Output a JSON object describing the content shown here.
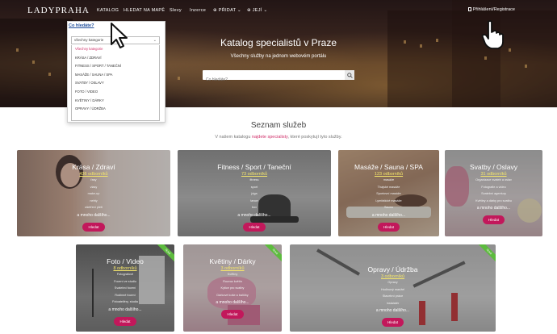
{
  "nav": {
    "logo": "LADYPRAHA",
    "items": [
      "KATALOG",
      "HLEDAT NA MAPĚ",
      "Slevy",
      "Inzerce",
      "⊕ PŘIDAT ⌄",
      "⊕ JEJÍ ⌄"
    ],
    "login": "Přihlášení/Registrace"
  },
  "hero": {
    "title": "Katalog specialistů v Praze",
    "subtitle": "Všechny služby na jednom webovém portálu",
    "search_placeholder": "Co hledáte?"
  },
  "dropdown": {
    "heading": "Co hledáte?",
    "selected": "všechny kategorie",
    "options": [
      "Všechny kategorie",
      "KRÁSA / ZDRAVÍ",
      "FITNESS / SPORT / TANEČNÍ",
      "MASÁŽE / SAUNA / SPA",
      "SVATBY / OSLAVY",
      "FOTO / VIDEO",
      "KVĚTINY / DÁRKY",
      "OPRAVY / ÚDRŽBA"
    ]
  },
  "section": {
    "title": "Seznam služeb",
    "subtitle_pre": "V našem katalogu ",
    "subtitle_link": "najdete specialisty",
    "subtitle_post": ", které poskytují tyto služby."
  },
  "cards": [
    {
      "title": "Krása / Zdraví",
      "count": "436 odborníků",
      "items": [
        "řasy",
        "vlasy",
        "make-up",
        "nehty",
        "ošetření pleti"
      ],
      "more": "a mnoho dalšího...",
      "button": "Hledat"
    },
    {
      "title": "Fitness / Sport / Taneční",
      "count": "73 odborníků",
      "items": [
        "fitness",
        "sport",
        "jóga",
        "tance",
        "box"
      ],
      "more": "a mnoho dalšího...",
      "button": "Hledat"
    },
    {
      "title": "Masáže / Sauna / SPA",
      "count": "123 odborníků",
      "items": [
        "masáže",
        "Thajské masáže",
        "Sportovní masáže",
        "Lymfatické masáže",
        "Saunu"
      ],
      "more": "a mnoho dalšího...",
      "button": "Hledat"
    },
    {
      "title": "Svatby / Oslavy",
      "count": "31 odborníků",
      "items": [
        "Organizace svateb a oslav",
        "Fotografie a video",
        "Svatební agentury",
        "Květiny a dárky pro svatbu"
      ],
      "more": "a mnoho dalšího...",
      "button": "Hledat"
    },
    {
      "title": "Foto / Video",
      "count": "8 odborníků",
      "items": [
        "Fotografové",
        "Focení ve studiu",
        "Svatební focení",
        "Rodinné focení",
        "Fotoateliéry, studia"
      ],
      "more": "a mnoho dalšího...",
      "button": "Hledat"
    },
    {
      "title": "Květiny / Dárky",
      "count": "3 odborníků",
      "items": [
        "Květiny",
        "Rozvoz květin",
        "Kytice pro svatby",
        "Dárkové koše a balíčky"
      ],
      "more": "a mnoho dalšího...",
      "button": "Hledat"
    },
    {
      "title": "Opravy / Údržba",
      "count": "3 odborníků",
      "items": [
        "Opravy",
        "Hodinový manžel",
        "Stavební práce",
        "Instalatér"
      ],
      "more": "a mnoho dalšího...",
      "button": "Hledat"
    }
  ],
  "badge": "Nové"
}
